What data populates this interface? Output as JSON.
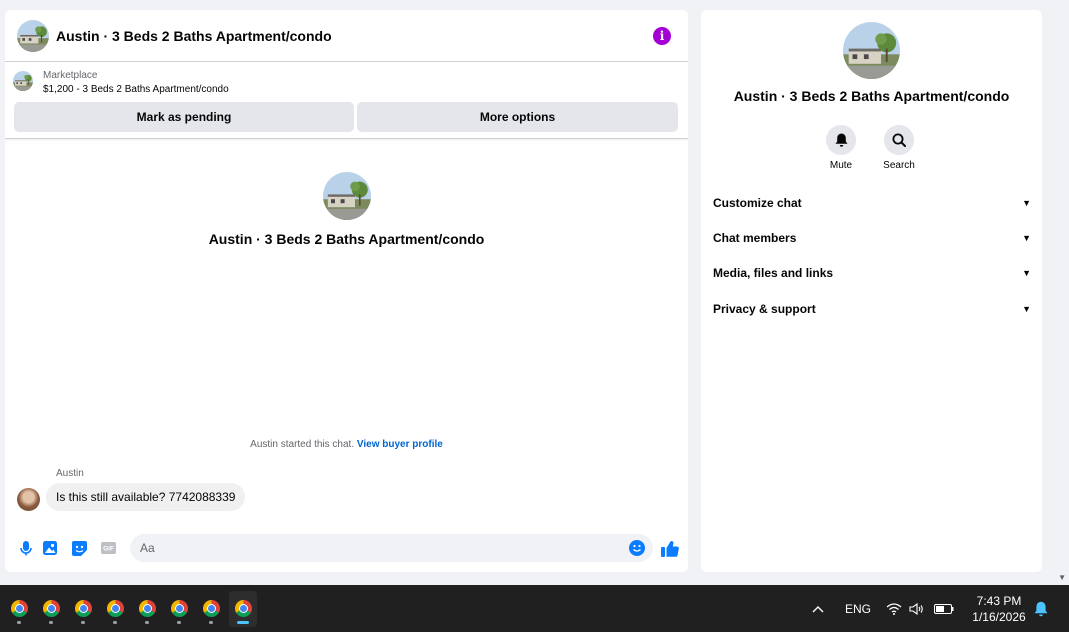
{
  "chat": {
    "title": "Austin · 3 Beds 2 Baths Apartment/condo",
    "info_glyph": "i",
    "marketplace": {
      "label": "Marketplace",
      "listing": "$1,200 - 3 Beds 2 Baths Apartment/condo",
      "pending_btn": "Mark as pending",
      "more_btn": "More options"
    },
    "center_title": "Austin · 3 Beds 2 Baths Apartment/condo",
    "started_text": "Austin started this chat.",
    "view_profile": "View buyer profile",
    "messages": [
      {
        "sender": "Austin",
        "text": "Is this still available? 7742088339"
      }
    ],
    "composer_placeholder": "Aa",
    "gif_label": "GIF"
  },
  "info_panel": {
    "title": "Austin · 3 Beds 2 Baths Apartment/condo",
    "actions": [
      {
        "label": "Mute",
        "icon": "bell-icon"
      },
      {
        "label": "Search",
        "icon": "search-icon"
      }
    ],
    "sections": [
      {
        "label": "Customize chat"
      },
      {
        "label": "Chat members"
      },
      {
        "label": "Media, files and links"
      },
      {
        "label": "Privacy & support"
      }
    ]
  },
  "taskbar": {
    "apps_count": 8,
    "lang": "ENG",
    "time": "7:43 PM",
    "date": "1/16/2026"
  },
  "colors": {
    "accent": "#0a7cff",
    "info": "#a400d6",
    "link": "#0064d1"
  }
}
